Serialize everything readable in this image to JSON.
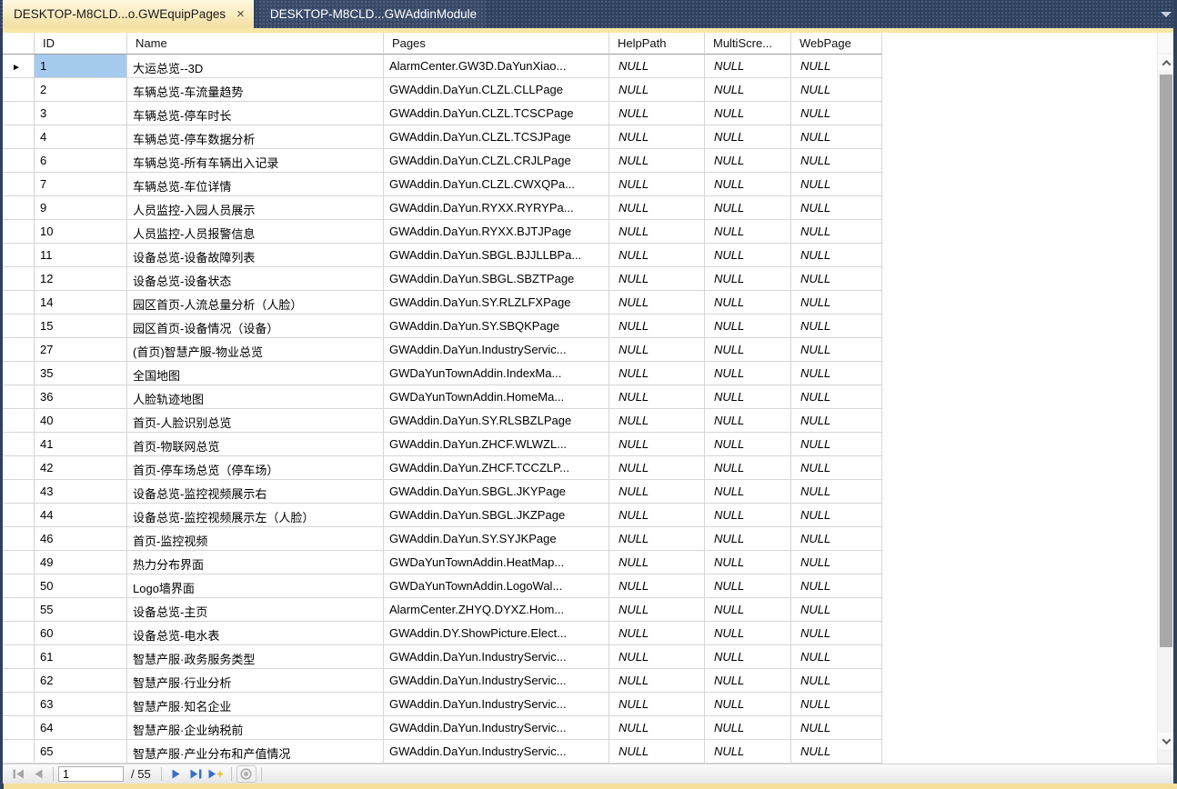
{
  "tabs": [
    {
      "label": "DESKTOP-M8CLD...o.GWEquipPages",
      "active": true
    },
    {
      "label": "DESKTOP-M8CLD...GWAddinModule",
      "active": false
    }
  ],
  "icons": {
    "close_glyph": "×",
    "row_arrow_glyph": "►"
  },
  "grid": {
    "columns": [
      "ID",
      "Name",
      "Pages",
      "HelpPath",
      "MultiScre...",
      "WebPage"
    ],
    "null_text": "NULL",
    "rows": [
      {
        "id": "1",
        "name": "大运总览--3D",
        "pages": "AlarmCenter.GW3D.DaYunXiao...",
        "help_path": "NULL",
        "multi_screen": "NULL",
        "web_page": "NULL"
      },
      {
        "id": "2",
        "name": "车辆总览-车流量趋势",
        "pages": "GWAddin.DaYun.CLZL.CLLPage",
        "help_path": "NULL",
        "multi_screen": "NULL",
        "web_page": "NULL"
      },
      {
        "id": "3",
        "name": "车辆总览-停车时长",
        "pages": "GWAddin.DaYun.CLZL.TCSCPage",
        "help_path": "NULL",
        "multi_screen": "NULL",
        "web_page": "NULL"
      },
      {
        "id": "4",
        "name": "车辆总览-停车数据分析",
        "pages": "GWAddin.DaYun.CLZL.TCSJPage",
        "help_path": "NULL",
        "multi_screen": "NULL",
        "web_page": "NULL"
      },
      {
        "id": "6",
        "name": "车辆总览-所有车辆出入记录",
        "pages": "GWAddin.DaYun.CLZL.CRJLPage",
        "help_path": "NULL",
        "multi_screen": "NULL",
        "web_page": "NULL"
      },
      {
        "id": "7",
        "name": "车辆总览-车位详情",
        "pages": "GWAddin.DaYun.CLZL.CWXQPa...",
        "help_path": "NULL",
        "multi_screen": "NULL",
        "web_page": "NULL"
      },
      {
        "id": "9",
        "name": "人员监控-入园人员展示",
        "pages": "GWAddin.DaYun.RYXX.RYRYPa...",
        "help_path": "NULL",
        "multi_screen": "NULL",
        "web_page": "NULL"
      },
      {
        "id": "10",
        "name": "人员监控-人员报警信息",
        "pages": "GWAddin.DaYun.RYXX.BJTJPage",
        "help_path": "NULL",
        "multi_screen": "NULL",
        "web_page": "NULL"
      },
      {
        "id": "11",
        "name": "设备总览-设备故障列表",
        "pages": "GWAddin.DaYun.SBGL.BJJLLBPa...",
        "help_path": "NULL",
        "multi_screen": "NULL",
        "web_page": "NULL"
      },
      {
        "id": "12",
        "name": "设备总览-设备状态",
        "pages": "GWAddin.DaYun.SBGL.SBZTPage",
        "help_path": "NULL",
        "multi_screen": "NULL",
        "web_page": "NULL"
      },
      {
        "id": "14",
        "name": "园区首页-人流总量分析（人脸）",
        "pages": "GWAddin.DaYun.SY.RLZLFXPage",
        "help_path": "NULL",
        "multi_screen": "NULL",
        "web_page": "NULL"
      },
      {
        "id": "15",
        "name": "园区首页-设备情况（设备）",
        "pages": "GWAddin.DaYun.SY.SBQKPage",
        "help_path": "NULL",
        "multi_screen": "NULL",
        "web_page": "NULL"
      },
      {
        "id": "27",
        "name": "(首页)智慧产服-物业总览",
        "pages": "GWAddin.DaYun.IndustryServic...",
        "help_path": "NULL",
        "multi_screen": "NULL",
        "web_page": "NULL"
      },
      {
        "id": "35",
        "name": "全国地图",
        "pages": "GWDaYunTownAddin.IndexMa...",
        "help_path": "NULL",
        "multi_screen": "NULL",
        "web_page": "NULL"
      },
      {
        "id": "36",
        "name": "人脸轨迹地图",
        "pages": "GWDaYunTownAddin.HomeMa...",
        "help_path": "NULL",
        "multi_screen": "NULL",
        "web_page": "NULL"
      },
      {
        "id": "40",
        "name": "首页-人脸识别总览",
        "pages": "GWAddin.DaYun.SY.RLSBZLPage",
        "help_path": "NULL",
        "multi_screen": "NULL",
        "web_page": "NULL"
      },
      {
        "id": "41",
        "name": "首页-物联网总览",
        "pages": "GWAddin.DaYun.ZHCF.WLWZL...",
        "help_path": "NULL",
        "multi_screen": "NULL",
        "web_page": "NULL"
      },
      {
        "id": "42",
        "name": "首页-停车场总览（停车场）",
        "pages": "GWAddin.DaYun.ZHCF.TCCZLP...",
        "help_path": "NULL",
        "multi_screen": "NULL",
        "web_page": "NULL"
      },
      {
        "id": "43",
        "name": "设备总览-监控视频展示右",
        "pages": "GWAddin.DaYun.SBGL.JKYPage",
        "help_path": "NULL",
        "multi_screen": "NULL",
        "web_page": "NULL"
      },
      {
        "id": "44",
        "name": "设备总览-监控视频展示左（人脸）",
        "pages": "GWAddin.DaYun.SBGL.JKZPage",
        "help_path": "NULL",
        "multi_screen": "NULL",
        "web_page": "NULL"
      },
      {
        "id": "46",
        "name": "首页-监控视频",
        "pages": "GWAddin.DaYun.SY.SYJKPage",
        "help_path": "NULL",
        "multi_screen": "NULL",
        "web_page": "NULL"
      },
      {
        "id": "49",
        "name": "热力分布界面",
        "pages": "GWDaYunTownAddin.HeatMap...",
        "help_path": "NULL",
        "multi_screen": "NULL",
        "web_page": "NULL"
      },
      {
        "id": "50",
        "name": "Logo墙界面",
        "pages": "GWDaYunTownAddin.LogoWal...",
        "help_path": "NULL",
        "multi_screen": "NULL",
        "web_page": "NULL"
      },
      {
        "id": "55",
        "name": "设备总览-主页",
        "pages": "AlarmCenter.ZHYQ.DYXZ.Hom...",
        "help_path": "NULL",
        "multi_screen": "NULL",
        "web_page": "NULL"
      },
      {
        "id": "60",
        "name": "设备总览-电水表",
        "pages": "GWAddin.DY.ShowPicture.Elect...",
        "help_path": "NULL",
        "multi_screen": "NULL",
        "web_page": "NULL"
      },
      {
        "id": "61",
        "name": "智慧产服·政务服务类型",
        "pages": "GWAddin.DaYun.IndustryServic...",
        "help_path": "NULL",
        "multi_screen": "NULL",
        "web_page": "NULL"
      },
      {
        "id": "62",
        "name": "智慧产服·行业分析",
        "pages": "GWAddin.DaYun.IndustryServic...",
        "help_path": "NULL",
        "multi_screen": "NULL",
        "web_page": "NULL"
      },
      {
        "id": "63",
        "name": "智慧产服·知名企业",
        "pages": "GWAddin.DaYun.IndustryServic...",
        "help_path": "NULL",
        "multi_screen": "NULL",
        "web_page": "NULL"
      },
      {
        "id": "64",
        "name": "智慧产服·企业纳税前",
        "pages": "GWAddin.DaYun.IndustryServic...",
        "help_path": "NULL",
        "multi_screen": "NULL",
        "web_page": "NULL"
      },
      {
        "id": "65",
        "name": "智慧产服·产业分布和产值情况",
        "pages": "GWAddin.DaYun.IndustryServic...",
        "help_path": "NULL",
        "multi_screen": "NULL",
        "web_page": "NULL"
      }
    ]
  },
  "navigator": {
    "current": "1",
    "total_label": "/ 55"
  },
  "colors": {
    "tab_bar_bg": "#2F415F",
    "active_tab_top": "#FFF8DF",
    "active_tab_bottom": "#F3DFA0",
    "accent_strip": "#F8E7A6",
    "bottom_strip": "#F3DF9B",
    "selected_cell": "#A5CBEF",
    "grid_line": "#D6D6D6",
    "header_underline": "#9C9C9C",
    "nav_enabled_arrow": "#366FC7",
    "nav_disabled_arrow": "#A6A6A6",
    "new_record_star": "#E8C73A",
    "scrollbar_thumb": "#A8A8A8"
  }
}
